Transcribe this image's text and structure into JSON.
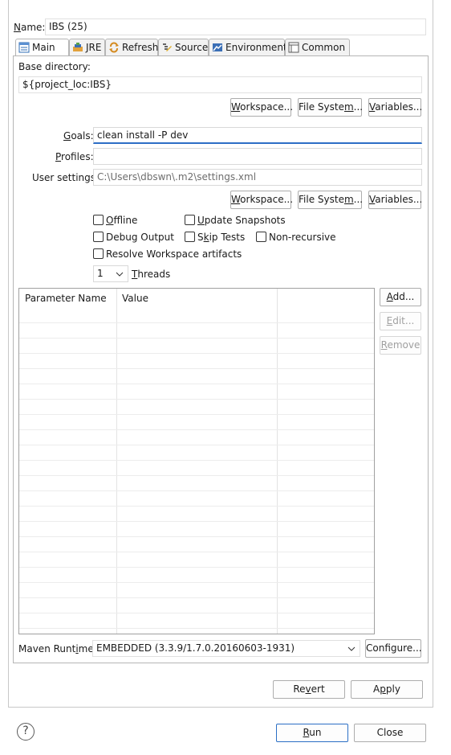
{
  "name": {
    "label": "Name:",
    "value": "IBS (25)"
  },
  "tabs": [
    {
      "label": "Main",
      "icon": "main-tab-icon"
    },
    {
      "label": "JRE",
      "icon": "jre-icon"
    },
    {
      "label": "Refresh",
      "icon": "refresh-icon"
    },
    {
      "label": "Source",
      "icon": "source-icon"
    },
    {
      "label": "Environment",
      "icon": "environment-icon"
    },
    {
      "label": "Common",
      "icon": "common-icon"
    }
  ],
  "base_directory": {
    "label": "Base directory:",
    "value": "${project_loc:IBS}",
    "buttons": {
      "workspace": "Workspace...",
      "file_system": "File System...",
      "variables": "Variables..."
    }
  },
  "goals": {
    "label": "Goals:",
    "value": "clean install -P dev"
  },
  "profiles": {
    "label": "Profiles:",
    "value": ""
  },
  "user_settings": {
    "label": "User settings:",
    "value": "C:\\Users\\dbswn\\.m2\\settings.xml",
    "buttons": {
      "workspace": "Workspace...",
      "file_system": "File System...",
      "variables": "Variables..."
    }
  },
  "options": {
    "offline": "Offline",
    "update_snapshots": "Update Snapshots",
    "debug_output": "Debug Output",
    "skip_tests": "Skip Tests",
    "non_recursive": "Non-recursive",
    "resolve_workspace": "Resolve Workspace artifacts"
  },
  "threads": {
    "value": "1",
    "label": "Threads"
  },
  "parameters": {
    "columns": [
      "Parameter Name",
      "Value"
    ],
    "rows": [],
    "buttons": {
      "add": "Add...",
      "edit": "Edit...",
      "remove": "Remove"
    }
  },
  "maven_runtime": {
    "label": "Maven Runtime:",
    "value": "EMBEDDED (3.3.9/1.7.0.20160603-1931)",
    "configure": "Configure..."
  },
  "footer": {
    "revert": "Revert",
    "apply": "Apply",
    "run": "Run",
    "close": "Close",
    "help": "?"
  }
}
